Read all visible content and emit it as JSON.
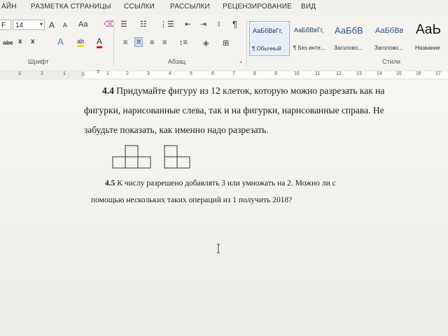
{
  "ribbon_tabs": [
    "АЙН",
    "РАЗМЕТКА СТРАНИЦЫ",
    "ССЫЛКИ",
    "РАССЫЛКИ",
    "РЕЦЕНЗИРОВАНИЕ",
    "ВИД"
  ],
  "font": {
    "name_fragment": "F",
    "size": "14",
    "grow": "A",
    "shrink": "A",
    "case": "Aa"
  },
  "format_buttons": {
    "strike": "abc",
    "sub": "x",
    "sup": "x",
    "text_effects": "A",
    "highlight": "ab",
    "font_color": "A"
  },
  "groups": {
    "font": "Шрифт",
    "paragraph": "Абзац",
    "styles": "Стили"
  },
  "styles": [
    {
      "preview": "АаБбВвГг,",
      "name": "¶ Обычный"
    },
    {
      "preview": "АаБбВвГг,",
      "name": "¶ Без инте..."
    },
    {
      "preview": "АаБбВ",
      "name": "Заголово..."
    },
    {
      "preview": "АаБбВв",
      "name": "Заголово..."
    },
    {
      "preview": "АаЬ",
      "name": "Название"
    }
  ],
  "ruler": {
    "left_numbers": [
      "3",
      "2",
      "1"
    ],
    "numbers": [
      "1",
      "2",
      "3",
      "4",
      "5",
      "6",
      "7",
      "8",
      "9",
      "10",
      "11",
      "12",
      "13",
      "14",
      "15",
      "16",
      "17"
    ]
  },
  "document": {
    "problem1": {
      "number": "4.4",
      "lines": [
        " Придумайте фигуру из 12 клеток, которую можно разрезать как на",
        "фигурки, нарисованные слева, так и на фигурки, нарисованные справа. Не",
        "забудьте показать, как именно надо разрезать."
      ]
    },
    "problem2": {
      "number": "4.5",
      "lines": [
        " К числу разрешено добавлять 3 или умножать на 2. Можно ли с",
        "помощью нескольких таких операций из 1 получить 2018?"
      ]
    }
  },
  "colors": {
    "page": "#f3f3f0",
    "ribbon": "#f4f3ef",
    "selected_style": "#e6eef9"
  }
}
